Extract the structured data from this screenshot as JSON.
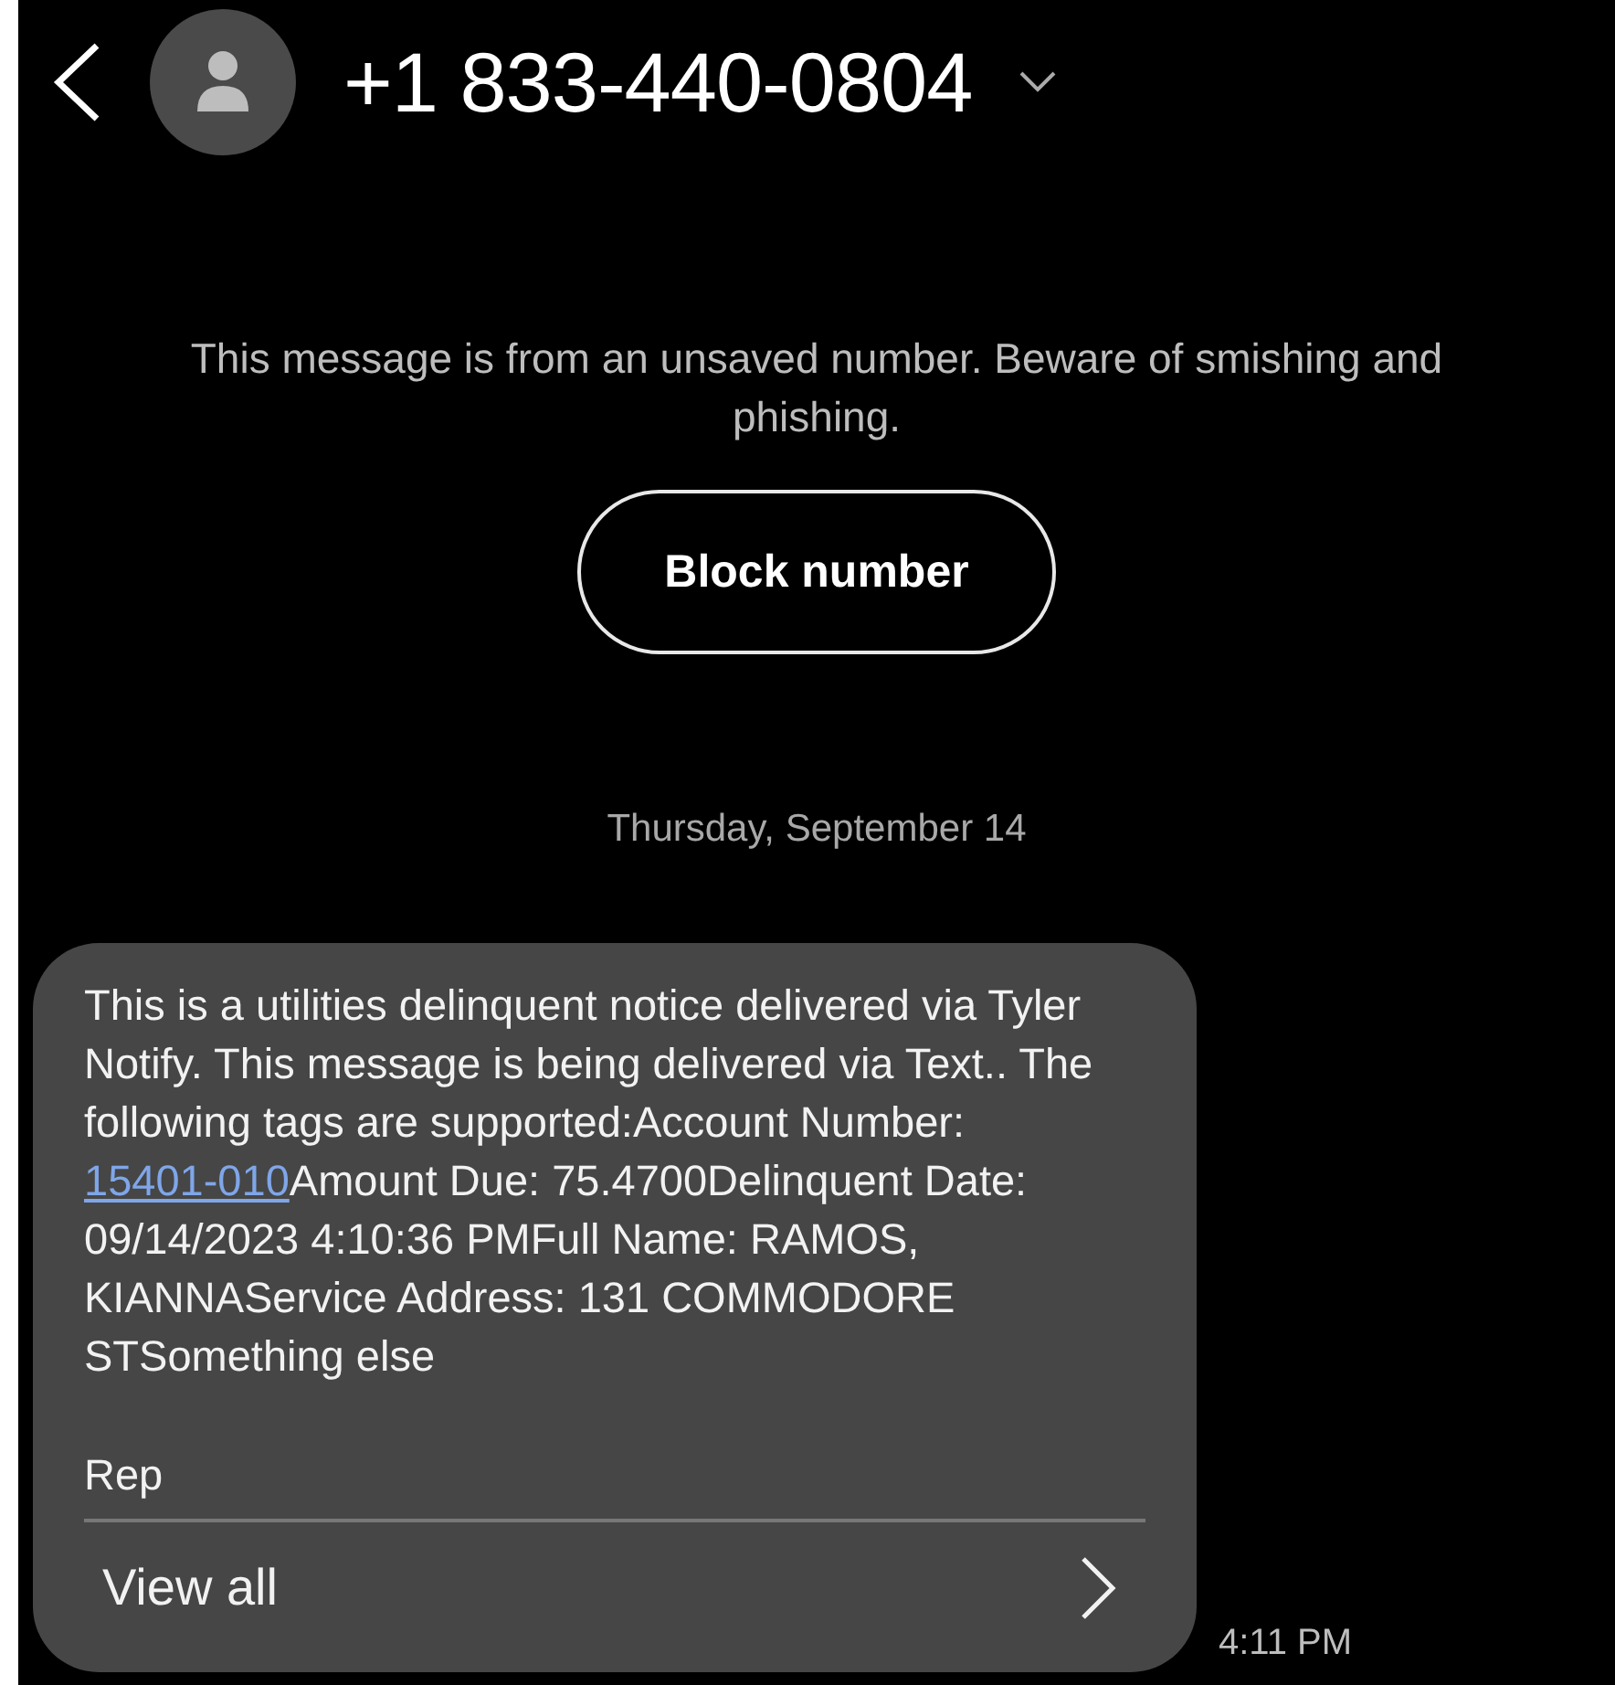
{
  "header": {
    "title": "+1 833-440-0804"
  },
  "warning": {
    "text": "This message is from an unsaved number. Beware of smishing and phishing.",
    "button": "Block number"
  },
  "date": "Thursday, September 14",
  "message": {
    "text_before": "This is a utilities delinquent notice delivered via Tyler Notify. This message is being delivered via Text.. The following tags are supported:Account Number: ",
    "link": "15401-010",
    "text_after": "Amount Due: 75.4700Delinquent Date: 09/14/2023 4:10:36 PMFull Name: RAMOS, KIANNAService Address: 131 COMMODORE STSomething else",
    "reply": "Rep",
    "view_all": "View all",
    "time": "4:11 PM"
  }
}
